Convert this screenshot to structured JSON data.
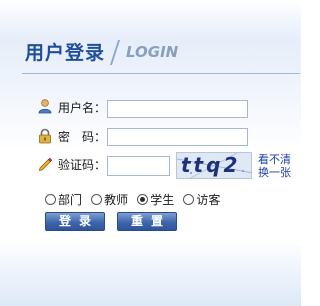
{
  "header": {
    "title_cn": "用户登录",
    "title_en": "LOGIN"
  },
  "form": {
    "username_label": "用户名：",
    "password_label": "密　码：",
    "captcha_label": "验证码：",
    "username_value": "",
    "password_value": "",
    "captcha_value": "",
    "captcha_image_text": "ttq2",
    "refresh_text": "看不清换一张"
  },
  "roles": {
    "selected": "学生",
    "options": [
      "部门",
      "教师",
      "学生",
      "访客"
    ]
  },
  "buttons": {
    "login": "登录",
    "reset": "重置"
  },
  "colors": {
    "title": "#1f4f9a",
    "button": "#3f66ad",
    "link": "#1e3ea8"
  }
}
